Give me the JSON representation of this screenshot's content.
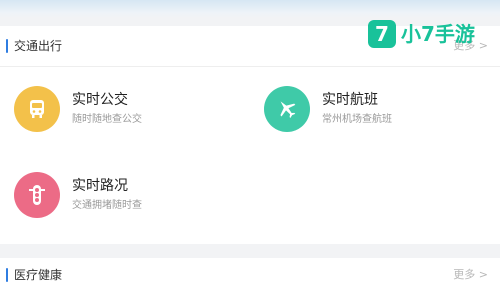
{
  "sections": {
    "transport": {
      "title": "交通出行",
      "more": "更多 >",
      "tiles": [
        {
          "title": "实时公交",
          "subtitle": "随时随地查公交",
          "icon": "bus-icon",
          "color": "#f3c14a"
        },
        {
          "title": "实时航班",
          "subtitle": "常州机场查航班",
          "icon": "airplane-icon",
          "color": "#3fcaa8"
        },
        {
          "title": "实时路况",
          "subtitle": "交通拥堵随时查",
          "icon": "traffic-light-icon",
          "color": "#ec6b86"
        }
      ]
    },
    "medical": {
      "title": "医疗健康",
      "more": "更多 >"
    }
  },
  "watermark": {
    "logo_glyph": "7",
    "brand_text": "小7手游",
    "color": "#19c29a"
  }
}
